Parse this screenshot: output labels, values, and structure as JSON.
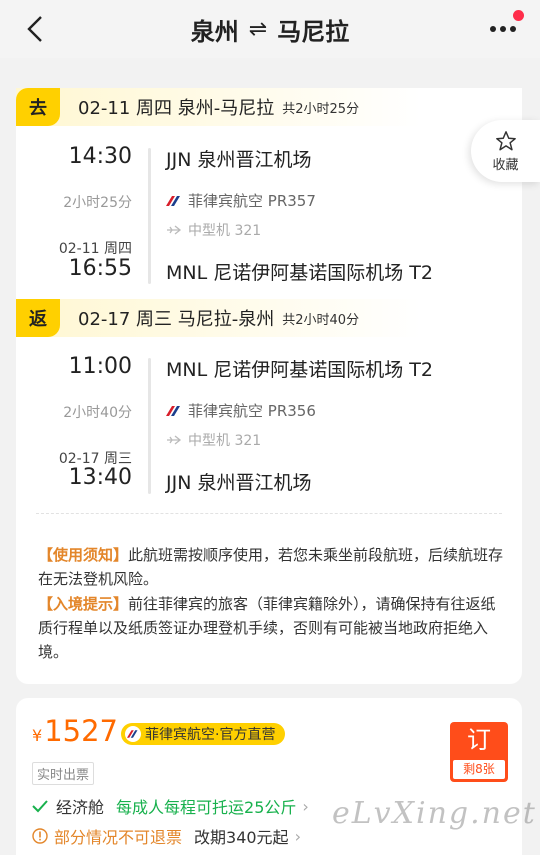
{
  "header": {
    "from": "泉州",
    "swap_icon": "⇌",
    "to": "马尼拉"
  },
  "favorite": {
    "label": "收藏"
  },
  "outbound": {
    "tag": "去",
    "title": "02-11 周四 泉州-马尼拉",
    "total": "共2小时25分",
    "dep_time": "14:30",
    "dep_airport": "JJN 泉州晋江机场",
    "duration": "2小时25分",
    "airline": "菲律宾航空 PR357",
    "aircraft": "中型机 321",
    "arr_date": "02-11 周四",
    "arr_time": "16:55",
    "arr_airport": "MNL 尼诺伊阿基诺国际机场 T2"
  },
  "return": {
    "tag": "返",
    "title": "02-17 周三 马尼拉-泉州",
    "total": "共2小时40分",
    "dep_time": "11:00",
    "dep_airport": "MNL 尼诺伊阿基诺国际机场 T2",
    "duration": "2小时40分",
    "airline": "菲律宾航空 PR356",
    "aircraft": "中型机 321",
    "arr_date": "02-17 周三",
    "arr_time": "13:40",
    "arr_airport": "JJN 泉州晋江机场"
  },
  "notices": {
    "usage_key": "【使用须知】",
    "usage_text": "此航班需按顺序使用，若您未乘坐前段航班，后续航班存在无法登机风险。",
    "entry_key": "【入境提示】",
    "entry_text": "前往菲律宾的旅客（菲律宾籍除外），请确保持有往返纸质行程单以及纸质签证办理登机手续，否则有可能被当地政府拒绝入境。"
  },
  "offer": {
    "currency": "¥",
    "price": "1527",
    "vendor": "菲律宾航空·官方直营",
    "ticketing": "实时出票",
    "book_label": "订",
    "remaining": "剩8张",
    "cabin": "经济舱",
    "baggage": "每成人每程可托运25公斤",
    "refund": "部分情况不可退票",
    "change_fee": "改期340元起"
  },
  "watermark": "eLvXing.net",
  "colors": {
    "accent": "#ffd000",
    "price": "#ff6a00",
    "book": "#ff4d1a",
    "green": "#18b14d",
    "orange": "#e3862a"
  }
}
